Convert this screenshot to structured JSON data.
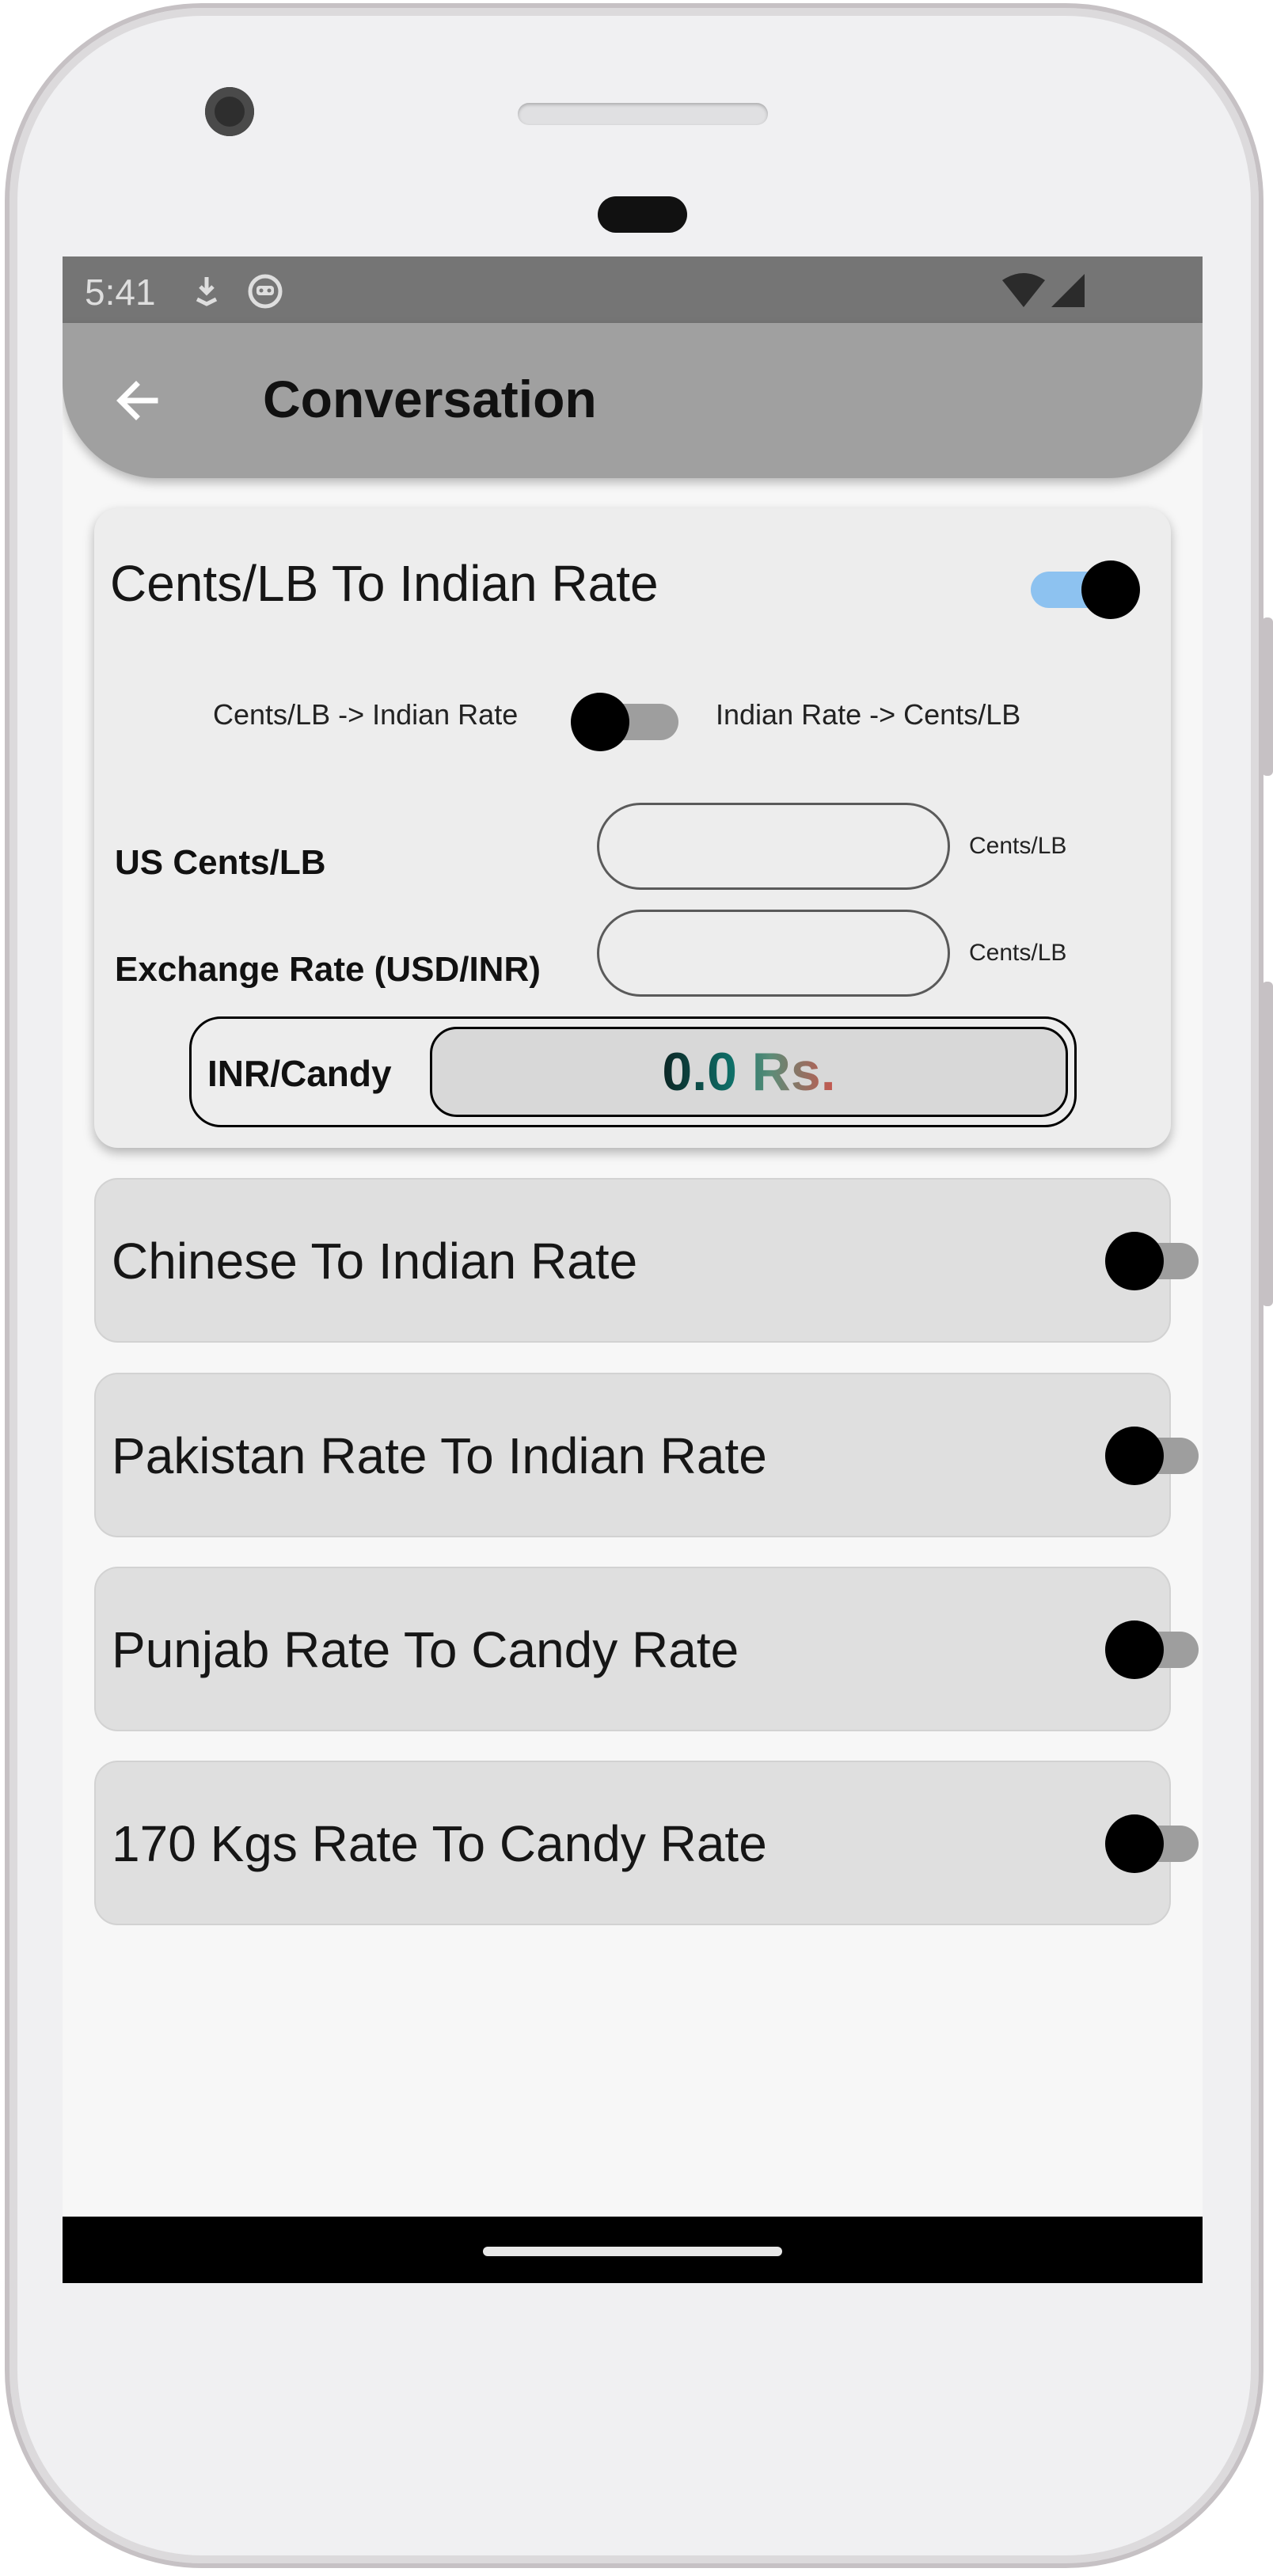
{
  "status_bar": {
    "time": "5:41"
  },
  "app_bar": {
    "title": "Conversation",
    "back_icon": "arrow-left-icon"
  },
  "cards": {
    "main": {
      "title": "Cents/LB To Indian Rate",
      "enabled": true,
      "direction_left": "Cents/LB -> Indian Rate",
      "direction_right": "Indian Rate -> Cents/LB",
      "direction_toggle_on": false,
      "fields": [
        {
          "label": "US Cents/LB",
          "value": "",
          "unit": "Cents/LB"
        },
        {
          "label": "Exchange Rate (USD/INR)",
          "value": "",
          "unit": "Cents/LB"
        }
      ],
      "result": {
        "label": "INR/Candy",
        "value": "0.0 Rs."
      }
    },
    "chinese": {
      "title": "Chinese To Indian Rate",
      "enabled": false
    },
    "pakistan": {
      "title": "Pakistan Rate To Indian Rate",
      "enabled": false
    },
    "punjab": {
      "title": "Punjab Rate To Candy Rate",
      "enabled": false
    },
    "kgs170": {
      "title": "170 Kgs Rate To Candy Rate",
      "enabled": false
    }
  },
  "colors": {
    "app_bar": "#a0a0a0",
    "status_bar": "#757575",
    "switch_on_track": "#8dc2f0",
    "switch_off_track": "#9e9e9e"
  }
}
